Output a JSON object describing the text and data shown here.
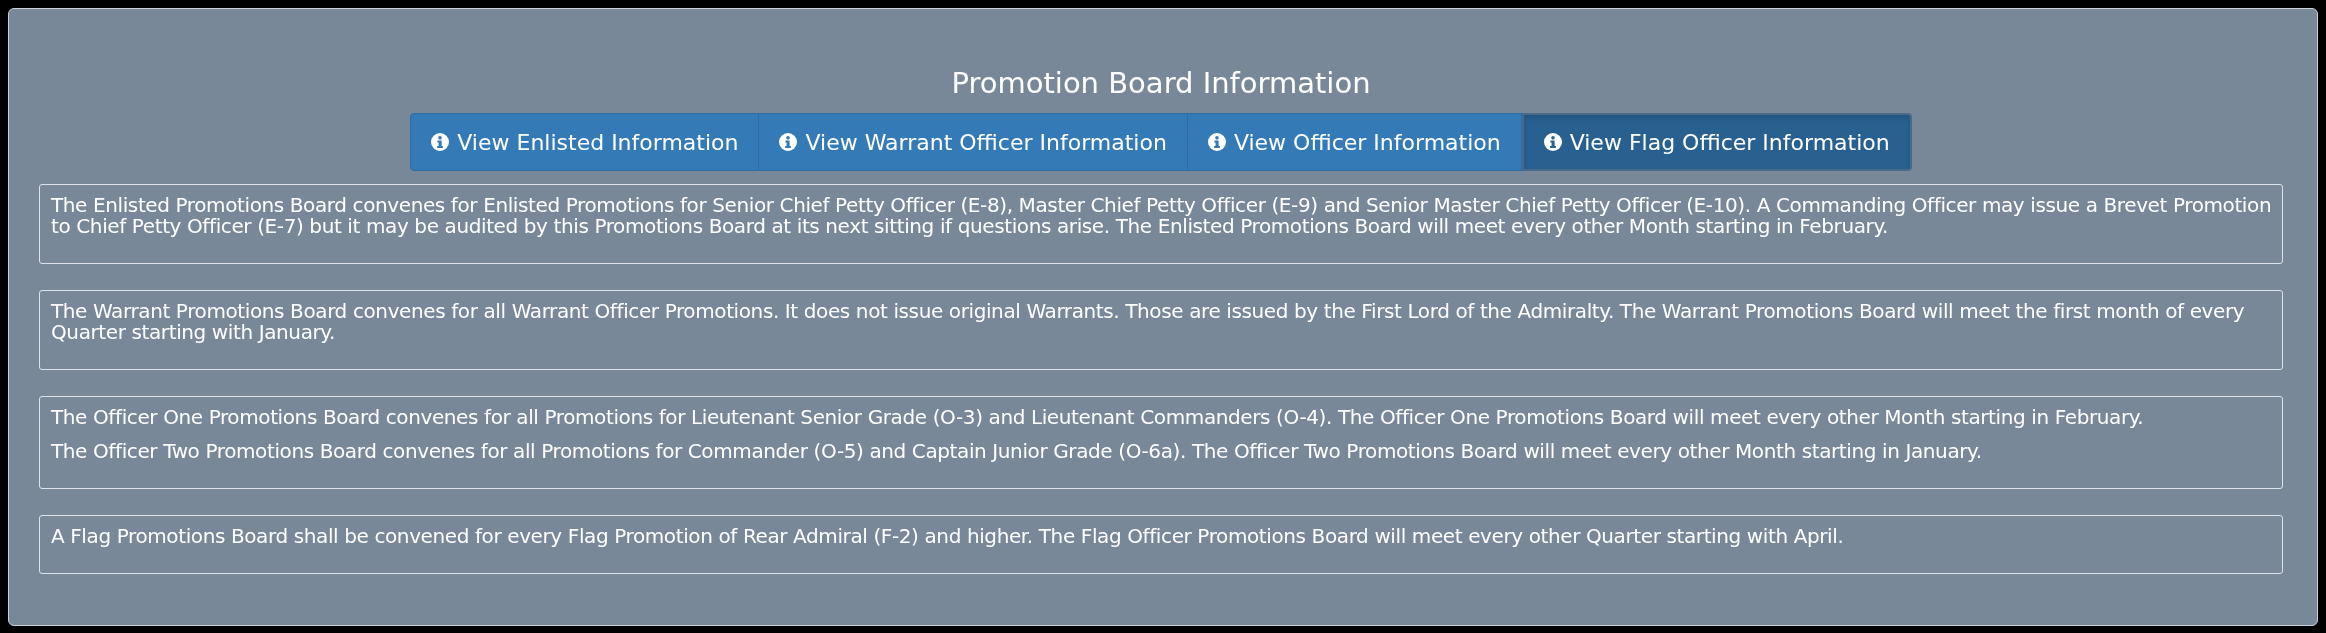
{
  "title": "Promotion Board Information",
  "tabs": [
    {
      "label": "View Enlisted Information",
      "selected": false
    },
    {
      "label": "View Warrant Officer Information",
      "selected": false
    },
    {
      "label": "View Officer Information",
      "selected": false
    },
    {
      "label": "View Flag Officer Information",
      "selected": true
    }
  ],
  "sections": [
    {
      "paragraphs": [
        "The Enlisted Promotions Board convenes for Enlisted Promotions for Senior Chief Petty Officer (E-8), Master Chief Petty Officer (E-9) and Senior Master Chief Petty Officer (E-10). A Commanding Officer may issue a Brevet Promotion to Chief Petty Officer (E-7) but it may be audited by this Promotions Board at its next sitting if questions arise. The Enlisted Promotions Board will meet every other Month starting in February."
      ]
    },
    {
      "paragraphs": [
        "The Warrant Promotions Board convenes for all Warrant Officer Promotions. It does not issue original Warrants. Those are issued by the First Lord of the Admiralty. The Warrant Promotions Board will meet the first month of every Quarter starting with January."
      ]
    },
    {
      "paragraphs": [
        "The Officer One Promotions Board convenes for all Promotions for Lieutenant Senior Grade (O-3) and Lieutenant Commanders (O-4). The Officer One Promotions Board will meet every other Month starting in February.",
        "The Officer Two Promotions Board convenes for all Promotions for Commander (O-5) and Captain Junior Grade (O-6a). The Officer Two Promotions Board will meet every other Month starting in January."
      ]
    },
    {
      "paragraphs": [
        "A Flag Promotions Board shall be convened for every Flag Promotion of Rear Admiral (F-2) and higher. The Flag Officer Promotions Board will meet every other Quarter starting with April."
      ]
    }
  ]
}
